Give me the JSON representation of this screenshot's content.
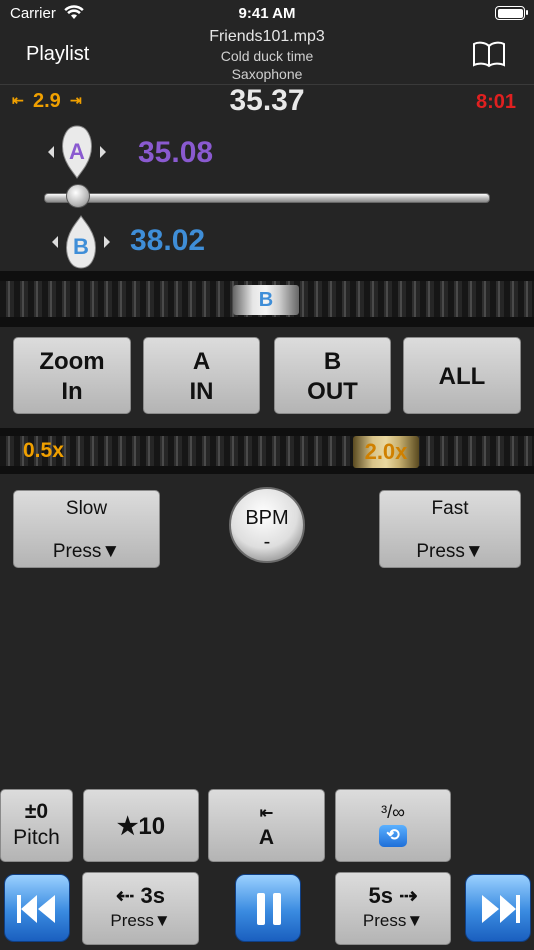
{
  "status_bar": {
    "carrier": "Carrier",
    "time": "9:41 AM"
  },
  "nav": {
    "playlist_label": "Playlist",
    "track_title": "Friends101.mp3",
    "track_subtitle": "Cold duck time",
    "track_instrument": "Saxophone",
    "book_icon": "book-icon"
  },
  "player": {
    "jump_back_icon": "⇤",
    "jump_value": "2.9",
    "jump_forward_icon": "⇥",
    "position": "35.37",
    "duration": "8:01",
    "a_label": "A",
    "a_time": "35.08",
    "b_label": "B",
    "b_time": "38.02",
    "jog_label": "B",
    "accent_a": "#8a5ad0",
    "accent_b": "#3f8ed8",
    "duration_color": "#e02020"
  },
  "loop_buttons": {
    "zoom_in_line1": "Zoom",
    "zoom_in_line2": "In",
    "a_in_line1": "A",
    "a_in_line2": "IN",
    "b_out_line1": "B",
    "b_out_line2": "OUT",
    "all_label": "ALL"
  },
  "speed": {
    "min_label": "0.5x",
    "current": "2.0x"
  },
  "tempo": {
    "slow_label": "Slow",
    "slow_sub": "Press▼",
    "bpm_label": "BPM",
    "bpm_value": "-",
    "fast_label": "Fast",
    "fast_sub": "Press▼"
  },
  "bottom_row1": {
    "pitch_top": "±0",
    "pitch_bottom": "Pitch",
    "fav_label": "★10",
    "goto_a_top": "⇤",
    "goto_a_bottom": "A",
    "loop_top": "³/∞",
    "loop_icon": "🔁"
  },
  "bottom_row2": {
    "back_label": "⇠ 3s",
    "back_sub": "Press▼",
    "fwd_label": "5s ⇢",
    "fwd_sub": "Press▼"
  }
}
